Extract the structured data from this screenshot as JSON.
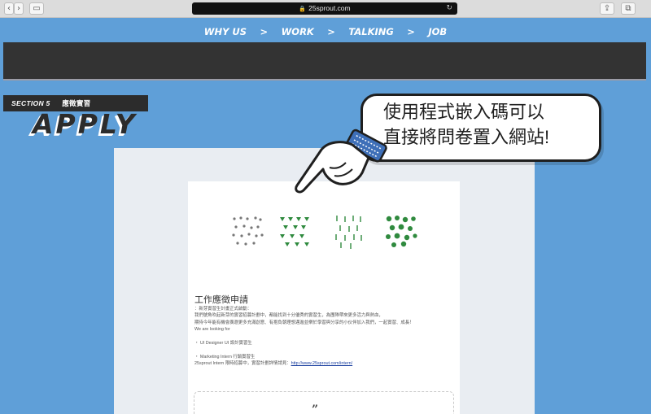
{
  "browser": {
    "url": "25sprout.com",
    "back_glyph": "‹",
    "forward_glyph": "›",
    "sidebar_glyph": "▭",
    "share_glyph": "⇪",
    "tabs_glyph": "⧉",
    "lock_glyph": "🔒",
    "reload_glyph": "↻"
  },
  "nav": {
    "items": [
      "WHY US",
      "WORK",
      "TALKING",
      "JOB"
    ],
    "separator": ">"
  },
  "section": {
    "label": "SECTION 5",
    "label_zh": "應徵實習",
    "title": "APPLY"
  },
  "callout": {
    "line1": "使用程式嵌入碼可以",
    "line2": "直接將問卷置入網站!"
  },
  "form": {
    "title": "工作應徵申請",
    "lines": [
      "：新芽實習生計畫正式啟動：",
      "我們號角吹起新芽的實習招募計劃中，都能找到十分優秀的實習生，為團隊帶來更多活力與熱血，",
      "期待今年能有機會廣邀更多充滿創意、有抱負朝理想邁進並樂於學習與分享的小伙伴加入我們，一起實習、成長！",
      "We are looking for"
    ],
    "items": [
      "・ UI Designer UI 設計實習生",
      "・ Marketing Intern 行銷實習生"
    ],
    "link_prefix": "25sprout Intern 限時招募中，實習計劃詳情請見：",
    "link_text": "http://www.25sprout.com/intern/",
    "quote_mark": "”"
  },
  "colors": {
    "page_bg": "#5f9fd8",
    "banner_bg": "#333333",
    "plant_green": "#2f8a3e",
    "plant_gray": "#777777"
  }
}
